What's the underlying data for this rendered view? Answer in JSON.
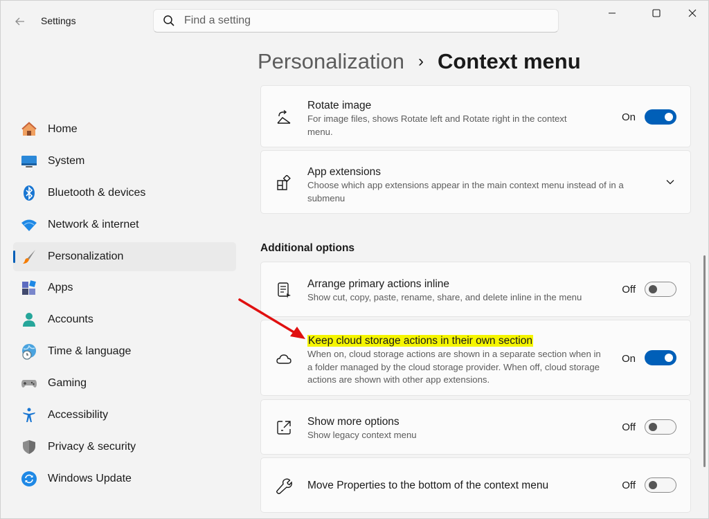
{
  "app": {
    "title": "Settings"
  },
  "search": {
    "placeholder": "Find a setting"
  },
  "window_controls": {
    "minimize": "minimize-icon",
    "maximize": "maximize-icon",
    "close": "close-icon"
  },
  "sidebar": {
    "items": [
      {
        "label": "Home",
        "icon": "home-icon",
        "active": false
      },
      {
        "label": "System",
        "icon": "system-icon",
        "active": false
      },
      {
        "label": "Bluetooth & devices",
        "icon": "bluetooth-icon",
        "active": false
      },
      {
        "label": "Network & internet",
        "icon": "wifi-icon",
        "active": false
      },
      {
        "label": "Personalization",
        "icon": "paintbrush-icon",
        "active": true
      },
      {
        "label": "Apps",
        "icon": "apps-icon",
        "active": false
      },
      {
        "label": "Accounts",
        "icon": "account-icon",
        "active": false
      },
      {
        "label": "Time & language",
        "icon": "globe-clock-icon",
        "active": false
      },
      {
        "label": "Gaming",
        "icon": "gamepad-icon",
        "active": false
      },
      {
        "label": "Accessibility",
        "icon": "accessibility-icon",
        "active": false
      },
      {
        "label": "Privacy & security",
        "icon": "shield-icon",
        "active": false
      },
      {
        "label": "Windows Update",
        "icon": "update-icon",
        "active": false
      }
    ]
  },
  "breadcrumb": {
    "parent": "Personalization",
    "separator": "›",
    "current": "Context menu"
  },
  "settings": {
    "rotate_image": {
      "title": "Rotate image",
      "desc": "For image files, shows Rotate left and Rotate right in the context menu.",
      "state": "On"
    },
    "app_extensions": {
      "title": "App extensions",
      "desc": "Choose which app extensions appear in the main context menu instead of in a submenu"
    }
  },
  "additional": {
    "heading": "Additional options",
    "arrange_inline": {
      "title": "Arrange primary actions inline",
      "desc": "Show cut, copy, paste, rename, share, and delete inline in the menu",
      "state": "Off"
    },
    "cloud_storage": {
      "title": "Keep cloud storage actions in their own section",
      "desc": "When on, cloud storage actions are shown in a separate section when in a folder managed by the cloud storage provider. When off, cloud storage actions are shown with other app extensions.",
      "state": "On"
    },
    "show_more": {
      "title": "Show more options",
      "desc": "Show legacy context menu",
      "state": "Off"
    },
    "move_properties": {
      "title": "Move Properties to the bottom of the context menu",
      "state": "Off"
    }
  },
  "colors": {
    "accent": "#005fb8",
    "highlight": "#f5f500",
    "annotation_arrow": "#e01010"
  }
}
